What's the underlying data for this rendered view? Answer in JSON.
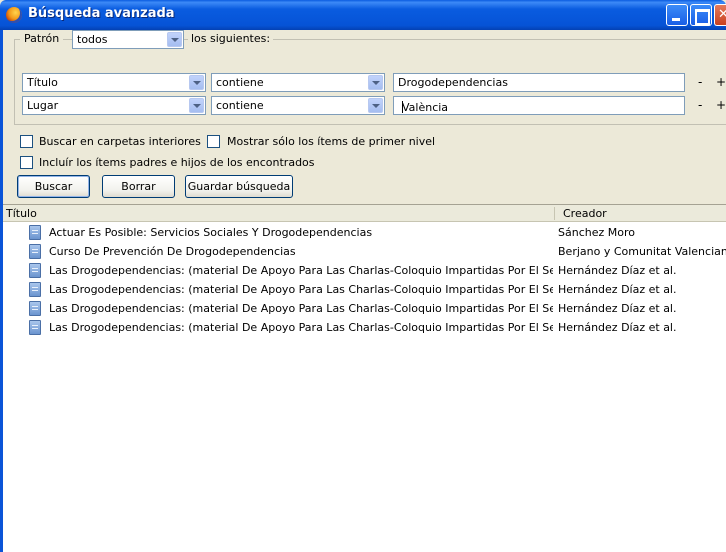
{
  "window": {
    "title": "Búsqueda avanzada"
  },
  "pattern": {
    "label": "Patrón",
    "mode": "todos",
    "suffix": "los siguientes:"
  },
  "conditions": [
    {
      "field": "Título",
      "operator": "contiene",
      "value": "Drogodependencias",
      "minus": "-",
      "plus": "+"
    },
    {
      "field": "Lugar",
      "operator": "contiene",
      "value": "València",
      "minus": "-",
      "plus": "+"
    }
  ],
  "options": {
    "subfolders": "Buscar en carpetas interiores",
    "top_level_only": "Mostrar sólo los ítems de primer nivel",
    "include_parents_children": "Incluír los ítems padres e hijos de los encontrados"
  },
  "buttons": {
    "search": "Buscar",
    "clear": "Borrar",
    "save": "Guardar búsqueda"
  },
  "results": {
    "columns": {
      "title": "Título",
      "creator": "Creador"
    },
    "rows": [
      {
        "title": "Actuar Es Posible: Servicios Sociales Y Drogodependencias",
        "creator": "Sánchez Moro"
      },
      {
        "title": "Curso De Prevención De Drogodependencias",
        "creator": "Berjano y Comunitat Valenciana"
      },
      {
        "title": "Las Drogodependencias: (material De Apoyo Para Las Charlas-Coloquio Impartidas Por El Servicio ...",
        "creator": "Hernández Díaz et al."
      },
      {
        "title": "Las Drogodependencias: (material De Apoyo Para Las Charlas-Coloquio Impartidas Por El Servicio ...",
        "creator": "Hernández Díaz et al."
      },
      {
        "title": "Las Drogodependencias: (material De Apoyo Para Las Charlas-Coloquio Impartidas Por El Servicio ...",
        "creator": "Hernández Díaz et al."
      },
      {
        "title": "Las Drogodependencias: (material De Apoyo Para Las Charlas-Coloquio Impartidas Por El Servicio ...",
        "creator": "Hernández Díaz et al."
      }
    ]
  }
}
